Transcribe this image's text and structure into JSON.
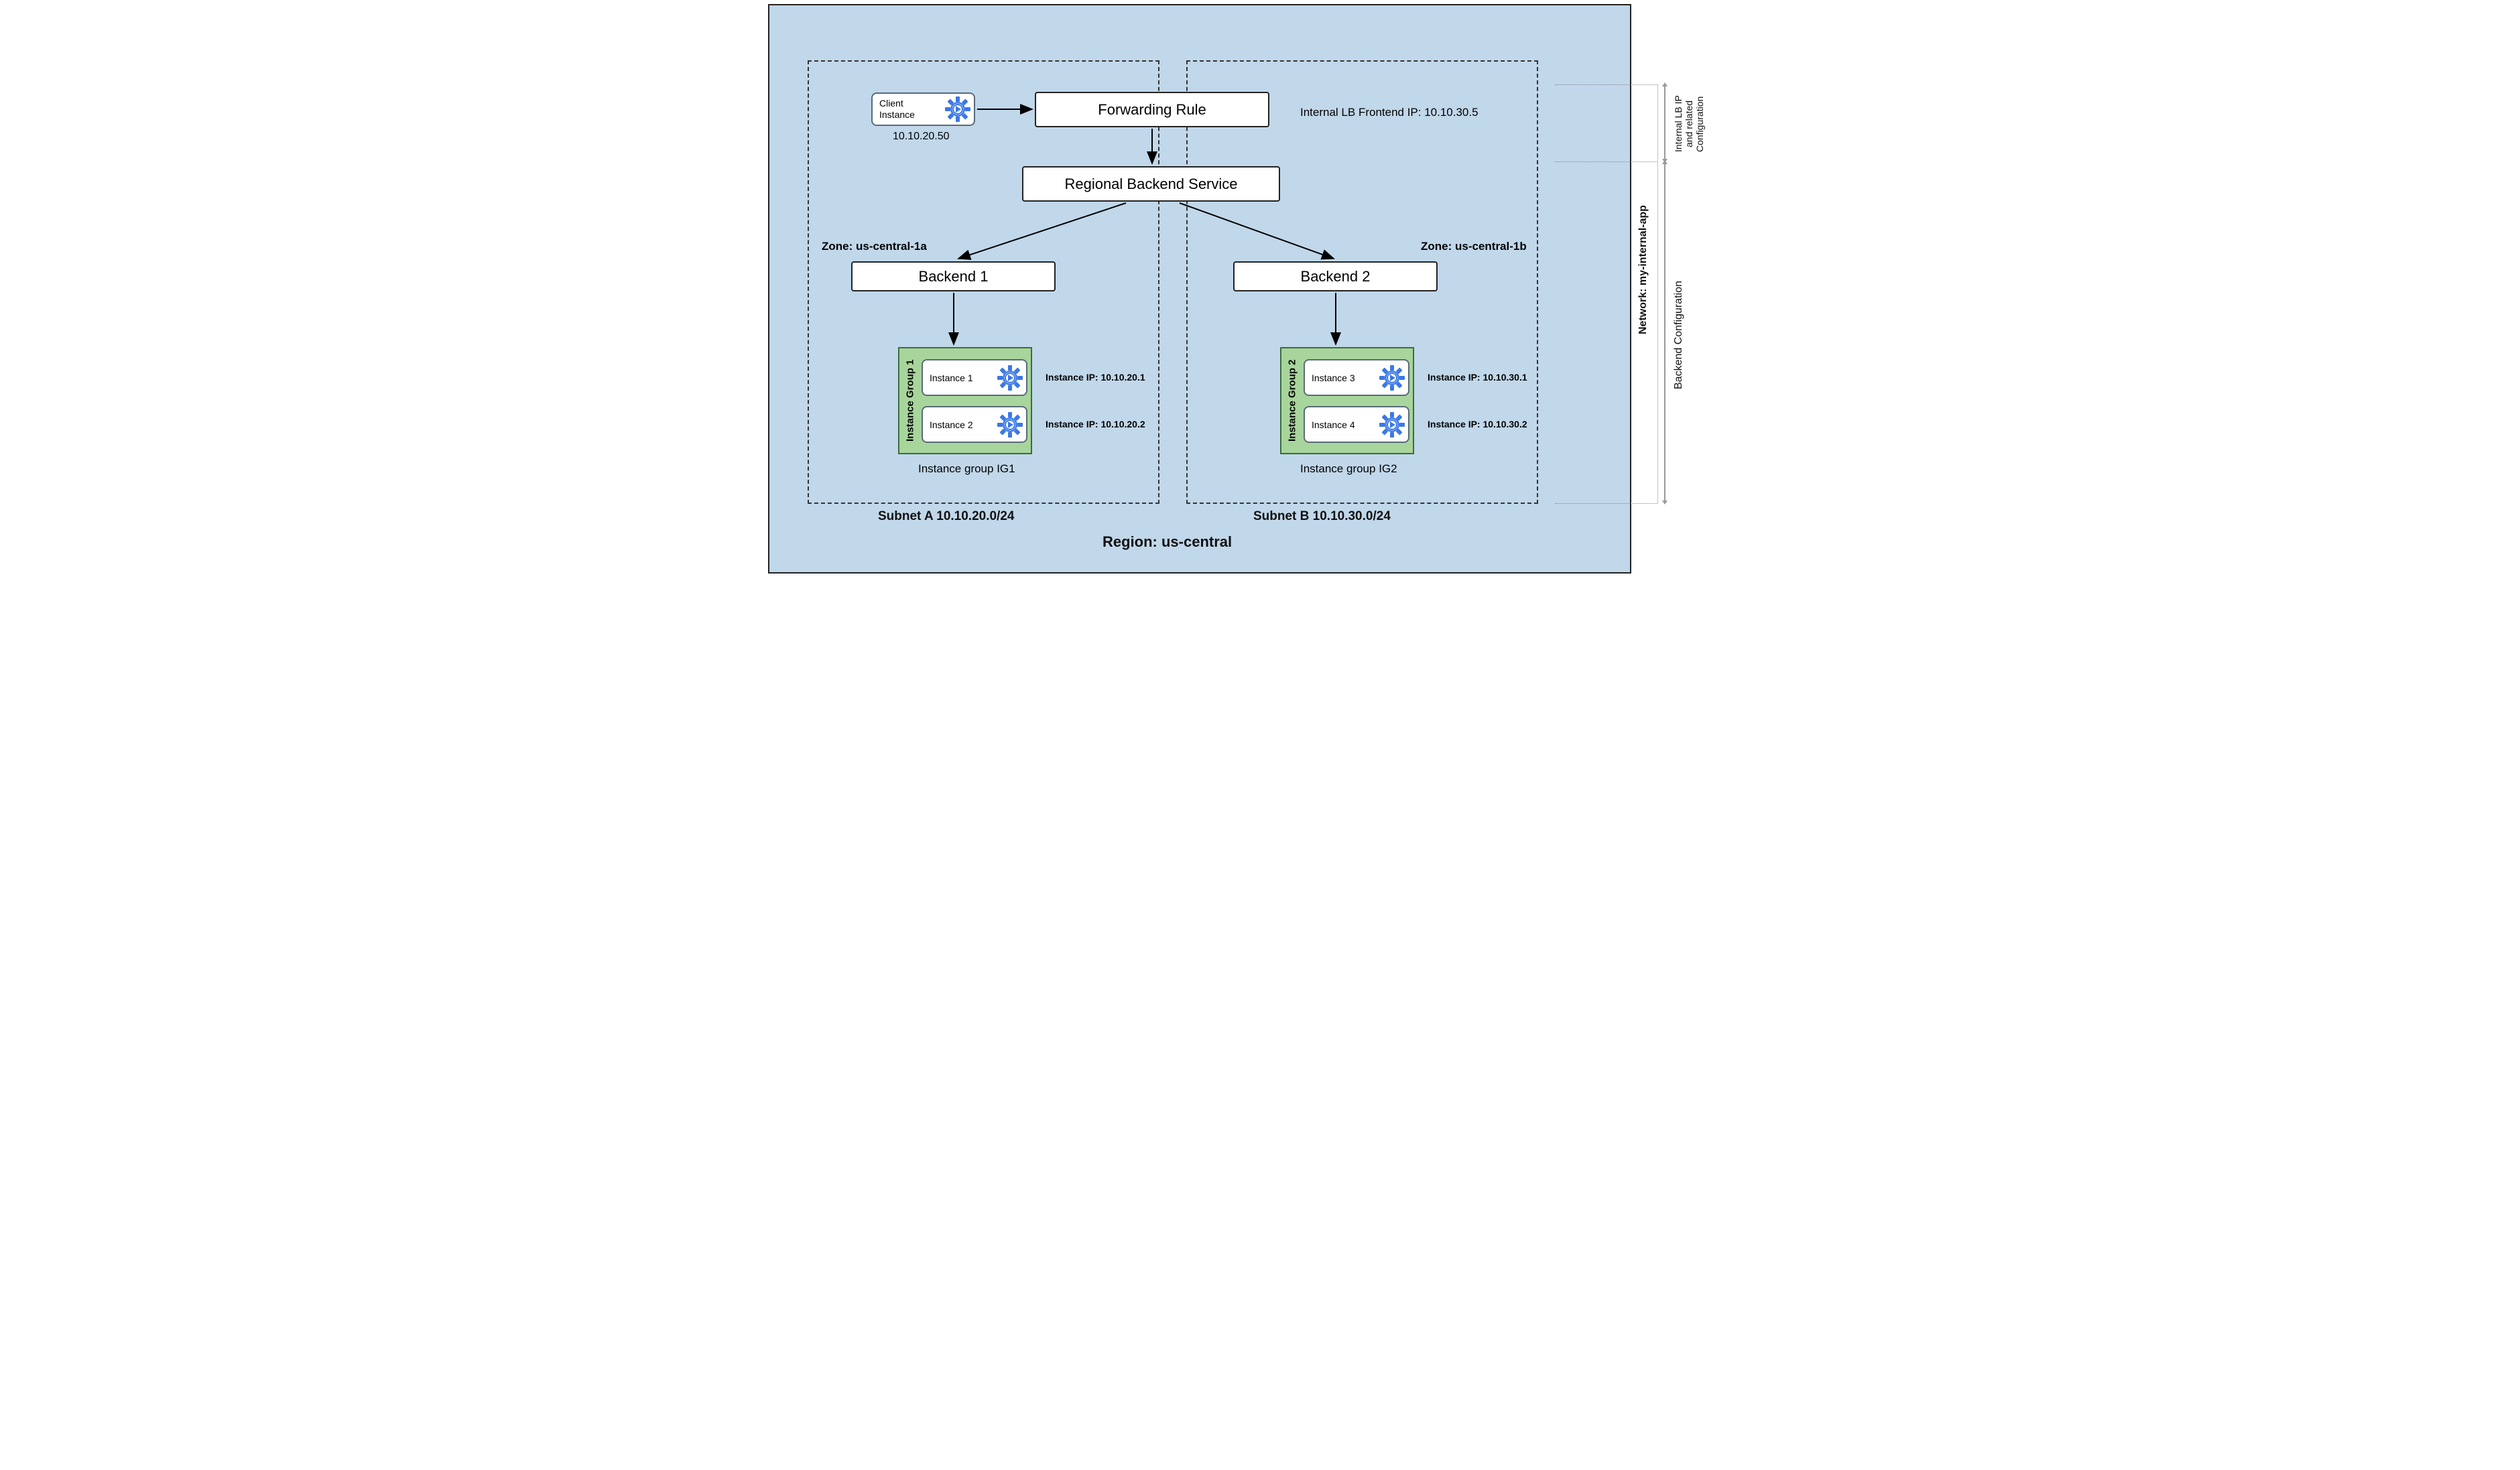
{
  "network_name": "Network: my-internal-app",
  "region_label": "Region: us-central",
  "right_labels": {
    "lb_ip": "Internal LB IP\nand related\nConfiguration",
    "backend": "Backend  Configuration"
  },
  "subnets": {
    "a": {
      "label": "Subnet A 10.10.20.0/24"
    },
    "b": {
      "label": "Subnet B 10.10.30.0/24"
    }
  },
  "client": {
    "label": "Client\nInstance",
    "ip": "10.10.20.50"
  },
  "forwarding_rule": {
    "label": "Forwarding Rule"
  },
  "frontend_ip_label": "Internal LB Frontend IP: 10.10.30.5",
  "backend_service": {
    "label": "Regional Backend Service"
  },
  "zones": {
    "a": "Zone: us-central-1a",
    "b": "Zone: us-central-1b"
  },
  "backends": {
    "b1": "Backend 1",
    "b2": "Backend 2"
  },
  "instance_groups": {
    "ig1": {
      "title": "Instance Group 1",
      "caption": "Instance group IG1",
      "instances": [
        {
          "name": "Instance 1",
          "ip_label": "Instance IP: 10.10.20.1"
        },
        {
          "name": "Instance 2",
          "ip_label": "Instance IP: 10.10.20.2"
        }
      ]
    },
    "ig2": {
      "title": "Instance Group 2",
      "caption": "Instance group IG2",
      "instances": [
        {
          "name": "Instance 3",
          "ip_label": "Instance IP: 10.10.30.1"
        },
        {
          "name": "Instance 4",
          "ip_label": "Instance IP: 10.10.30.2"
        }
      ]
    }
  }
}
